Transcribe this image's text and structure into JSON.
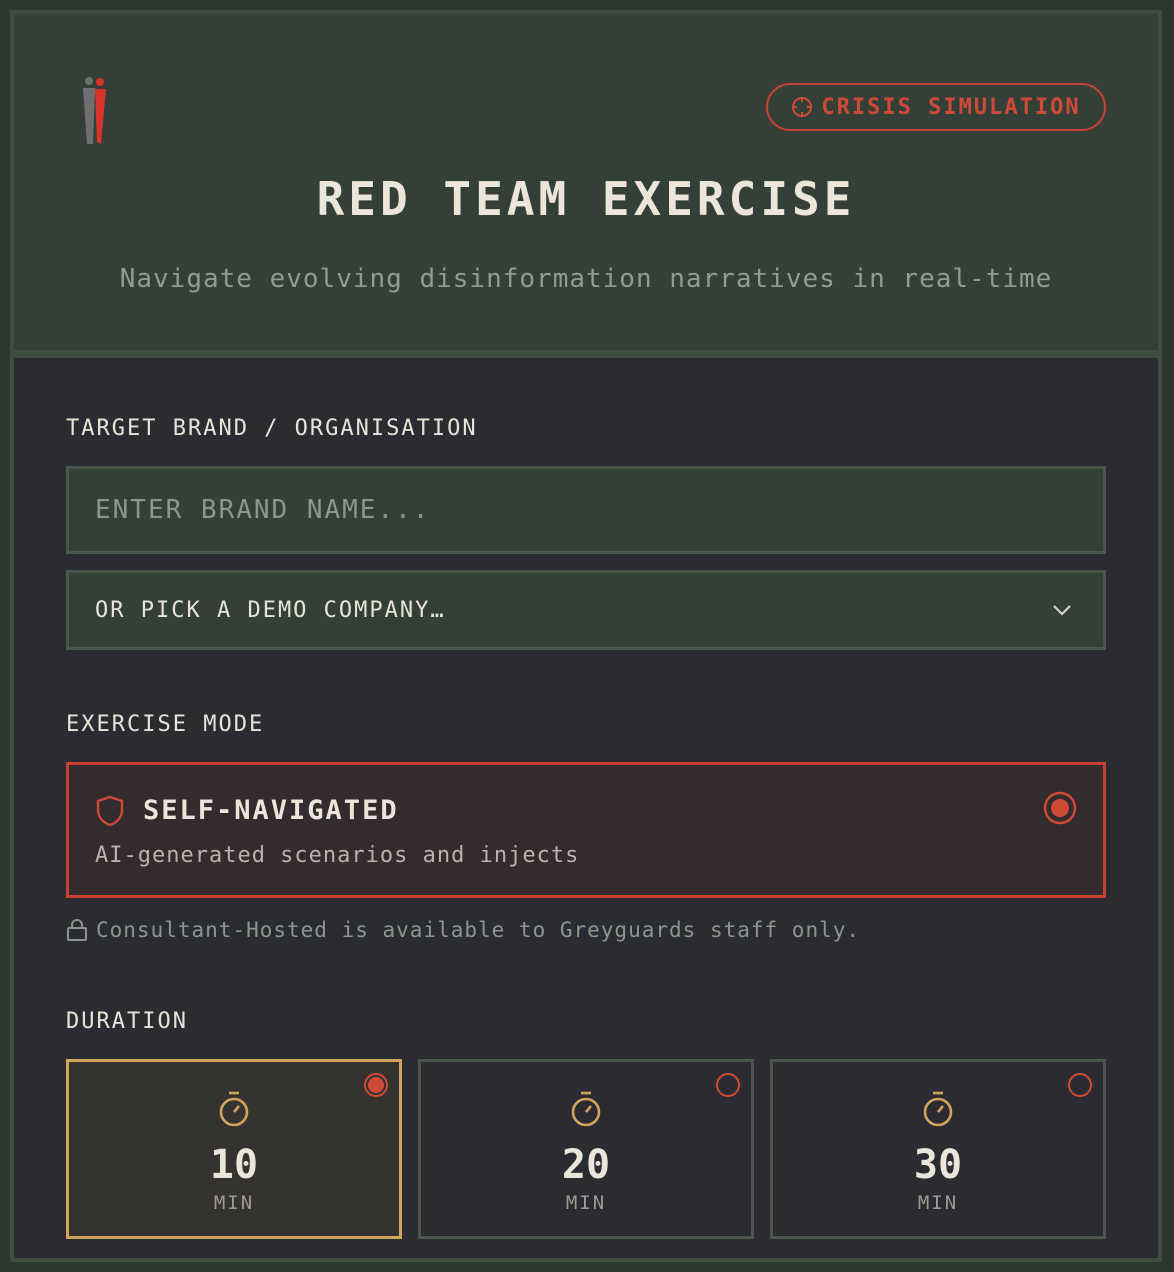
{
  "header": {
    "badge_label": "CRISIS SIMULATION",
    "title": "RED TEAM EXERCISE",
    "subtitle": "Navigate evolving disinformation narratives in real-time"
  },
  "target": {
    "label": "TARGET BRAND / ORGANISATION",
    "input_value": "",
    "input_placeholder": "ENTER BRAND NAME...",
    "demo_select_value": "OR PICK A DEMO COMPANY…"
  },
  "mode": {
    "label": "EXERCISE MODE",
    "options": [
      {
        "title": "SELF-NAVIGATED",
        "description": "AI-generated scenarios and injects",
        "selected": true
      }
    ],
    "note": "Consultant-Hosted is available to Greyguards staff only."
  },
  "duration": {
    "label": "DURATION",
    "options": [
      {
        "value": "10",
        "unit": "MIN",
        "selected": true
      },
      {
        "value": "20",
        "unit": "MIN",
        "selected": false
      },
      {
        "value": "30",
        "unit": "MIN",
        "selected": false
      }
    ]
  },
  "colors": {
    "accent_red": "#c7412f",
    "accent_gold": "#d3a25b",
    "header_bg": "#343f38",
    "panel_bg": "#2a2c32"
  },
  "icons": [
    "logo-figures",
    "crosshair-icon",
    "chevron-down-icon",
    "shield-icon",
    "radio-selected",
    "lock-icon",
    "timer-icon",
    "radio-unselected"
  ]
}
